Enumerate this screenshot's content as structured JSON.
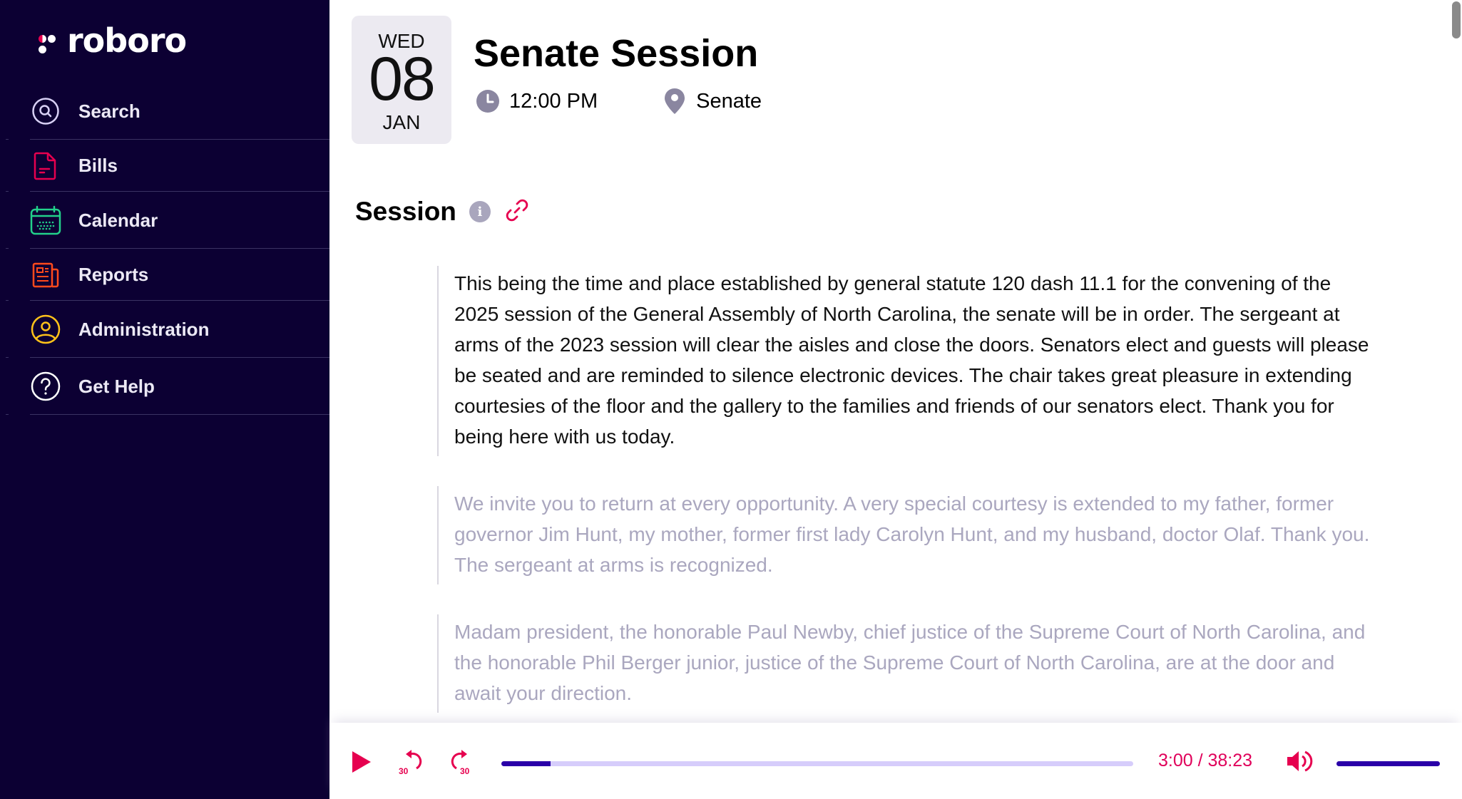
{
  "brand": {
    "name": "roboro"
  },
  "sidebar": {
    "items": [
      {
        "label": "Search",
        "icon": "search-icon",
        "color": "#d8d0f5"
      },
      {
        "label": "Bills",
        "icon": "document-icon",
        "color": "#e6004f"
      },
      {
        "label": "Calendar",
        "icon": "calendar-icon",
        "color": "#22d18b"
      },
      {
        "label": "Reports",
        "icon": "newspaper-icon",
        "color": "#ff4a1c"
      },
      {
        "label": "Administration",
        "icon": "user-circle-icon",
        "color": "#ffc21a"
      },
      {
        "label": "Get Help",
        "icon": "help-circle-icon",
        "color": "#ffffff"
      }
    ]
  },
  "event": {
    "date": {
      "weekday": "WED",
      "day": "08",
      "month": "JAN"
    },
    "title": "Senate Session",
    "time": "12:00 PM",
    "location": "Senate"
  },
  "section": {
    "title": "Session",
    "info_icon": "i"
  },
  "transcript": [
    {
      "text": "This being the time and place established by general statute 120 dash 11.1 for the convening of the 2025 session of the General Assembly of North Carolina, the senate will be in order. The sergeant at arms of the 2023 session will clear the aisles and close the doors. Senators elect and guests will please be seated and are reminded to silence electronic devices. The chair takes great pleasure in extending courtesies of the floor and the gallery to the families and friends of our senators elect. Thank you for being here with us today.",
      "active": true
    },
    {
      "text": "We invite you to return at every opportunity. A very special courtesy is extended to my father, former governor Jim Hunt, my mother, former first lady Carolyn Hunt, and my husband, doctor Olaf. Thank you. The sergeant at arms is recognized.",
      "active": false
    },
    {
      "text": "Madam president, the honorable Paul Newby, chief justice of the Supreme Court of North Carolina, and the honorable Phil Berger junior, justice of the Supreme Court of North Carolina, are at the door and await your direction.",
      "active": false
    }
  ],
  "player": {
    "rewind_label": "30",
    "forward_label": "30",
    "current_time": "3:00",
    "duration": "38:23",
    "time_display": "3:00 / 38:23",
    "progress_fraction": 0.078,
    "volume_fraction": 1.0
  },
  "colors": {
    "sidebar_bg": "#0c0033",
    "accent": "#e0005a",
    "progress_fill": "#2a00a8",
    "progress_track": "#d6cdfb",
    "muted_text": "#aaa7bf"
  }
}
